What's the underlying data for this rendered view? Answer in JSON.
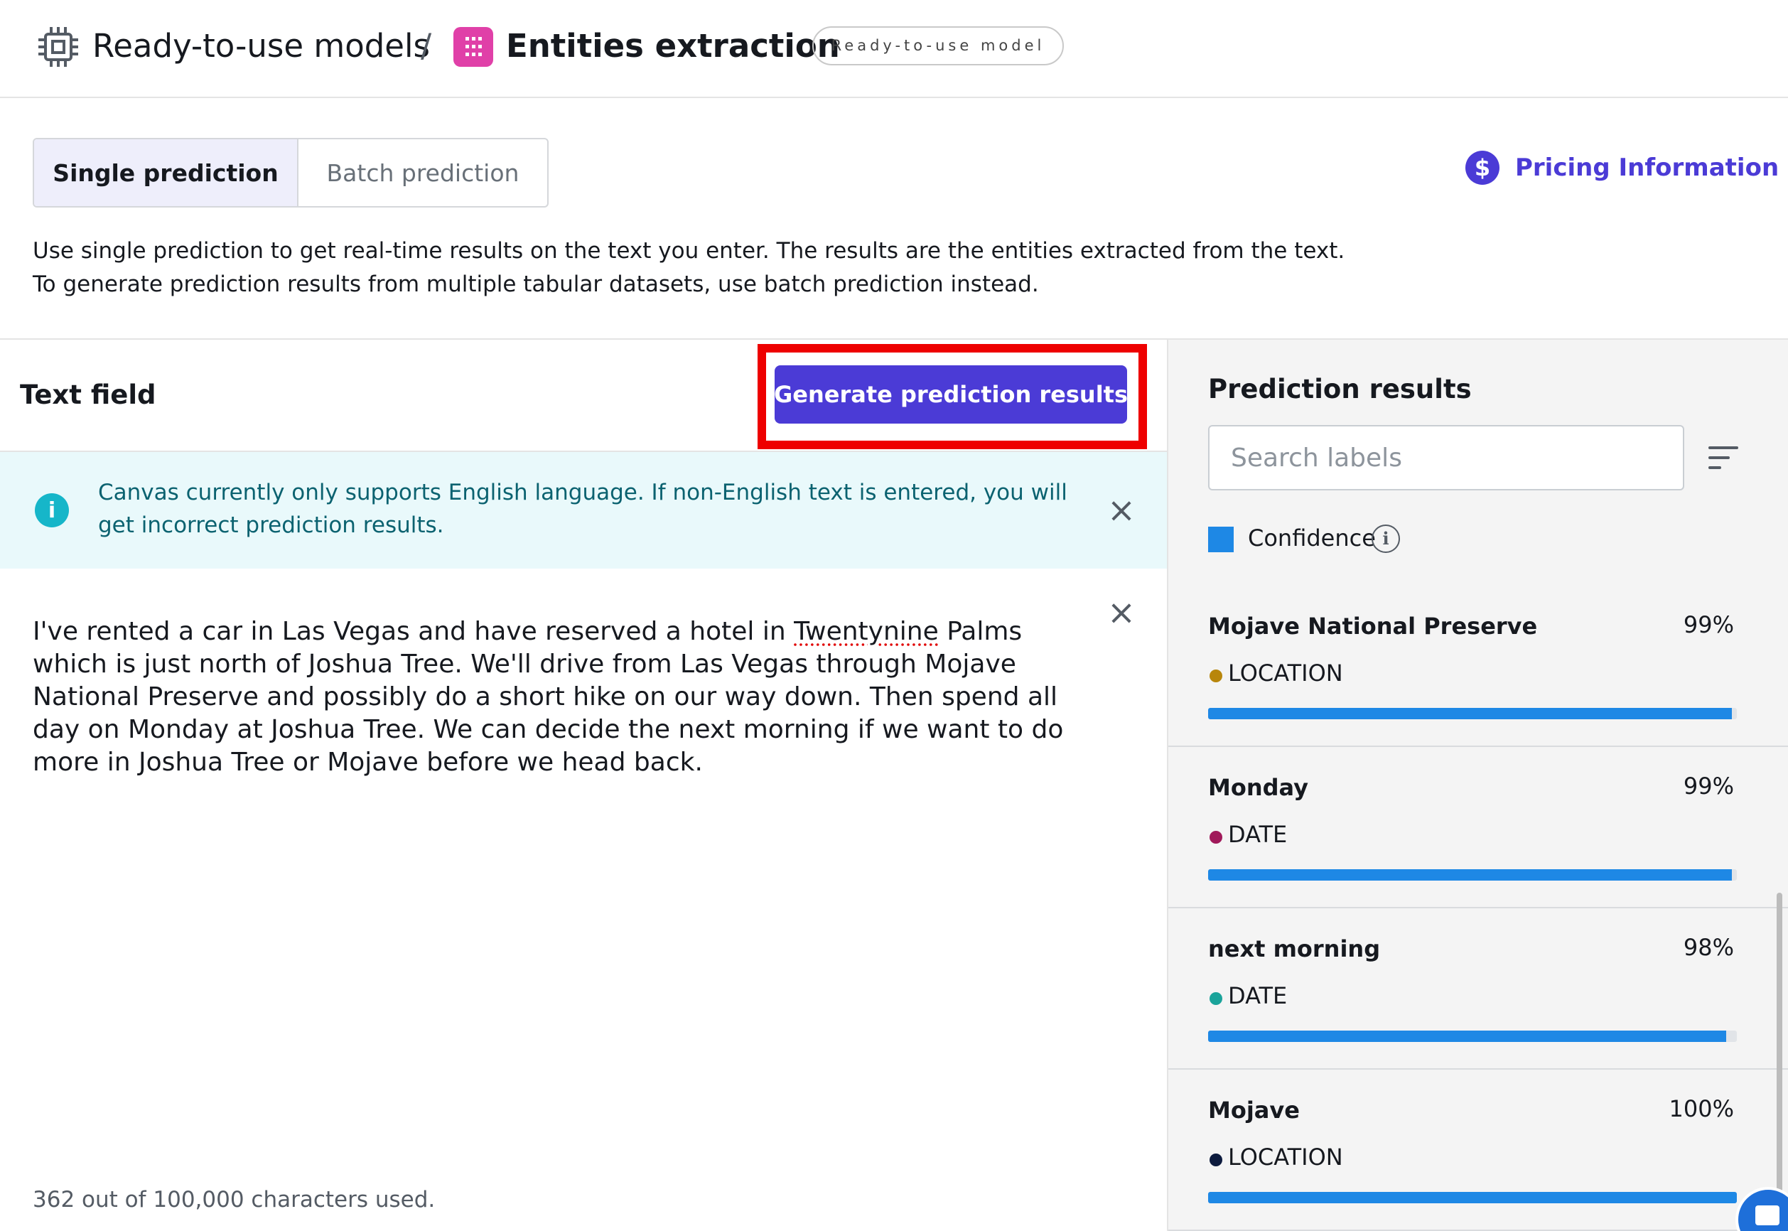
{
  "header": {
    "breadcrumb_parent": "Ready-to-use models",
    "breadcrumb_separator": "/",
    "title": "Entities extraction",
    "badge": "Ready-to-use model"
  },
  "tabs": [
    {
      "label": "Single prediction",
      "selected": true
    },
    {
      "label": "Batch prediction",
      "selected": false
    }
  ],
  "pricing": {
    "icon": "dollar-icon",
    "label": "Pricing Information"
  },
  "description": {
    "line1": "Use single prediction to get real-time results on the text you enter. The results are the entities extracted from the text.",
    "line2": "To generate prediction results from multiple tabular datasets, use batch prediction instead."
  },
  "text_field": {
    "title": "Text field",
    "generate_button": "Generate prediction results",
    "info_message": "Canvas currently only supports English language. If non-English text is entered, you will get incorrect prediction results.",
    "text_before": "I've rented a car in Las Vegas and have reserved a hotel in ",
    "text_misspelled": "Twentynine",
    "text_after": " Palms which is just north of Joshua Tree. We'll drive from Las Vegas through Mojave National Preserve and possibly do a short hike on our way down. Then spend all day on Monday at Joshua Tree. We can decide the next morning if we want to do more in Joshua Tree or Mojave before we head back.",
    "char_count": "362 out of 100,000 characters used."
  },
  "prediction_results": {
    "title": "Prediction results",
    "search_placeholder": "Search labels",
    "legend_label": "Confidence",
    "bar_color": "#1e88e5",
    "items": [
      {
        "name": "Mojave National Preserve",
        "confidence_label": "99%",
        "confidence": 0.99,
        "type": "LOCATION",
        "dot_color": "#b8860b"
      },
      {
        "name": "Monday",
        "confidence_label": "99%",
        "confidence": 0.99,
        "type": "DATE",
        "dot_color": "#a0195a"
      },
      {
        "name": "next morning",
        "confidence_label": "98%",
        "confidence": 0.98,
        "type": "DATE",
        "dot_color": "#1aa39a"
      },
      {
        "name": "Mojave",
        "confidence_label": "100%",
        "confidence": 1.0,
        "type": "LOCATION",
        "dot_color": "#0d1b3e"
      }
    ]
  },
  "colors": {
    "accent": "#4b3bd6",
    "highlight": "#ee0000",
    "info_bg": "#e9f9fb"
  }
}
